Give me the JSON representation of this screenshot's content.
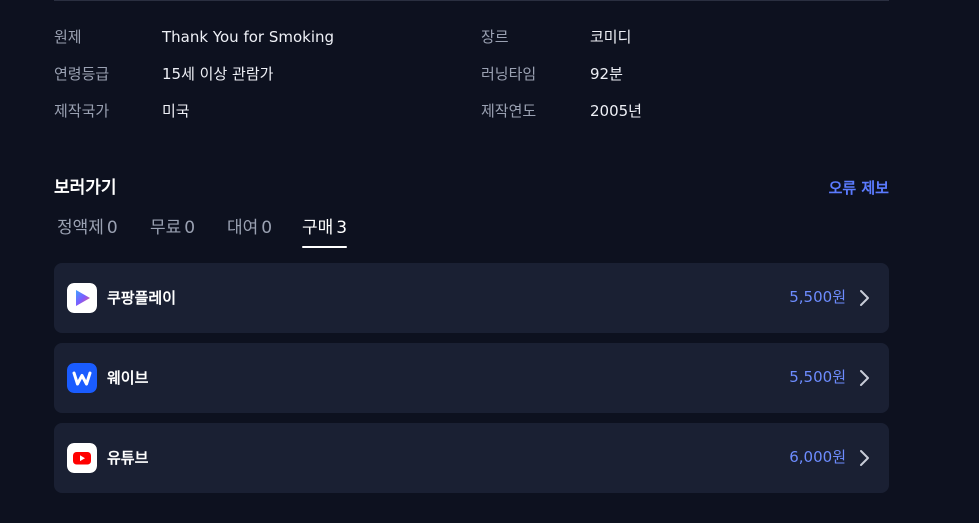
{
  "info": {
    "rows": [
      {
        "label1": "원제",
        "value1": "Thank You for Smoking",
        "label2": "장르",
        "value2": "코미디"
      },
      {
        "label1": "연령등급",
        "value1": "15세 이상 관람가",
        "label2": "러닝타임",
        "value2": "92분"
      },
      {
        "label1": "제작국가",
        "value1": "미국",
        "label2": "제작연도",
        "value2": "2005년"
      }
    ]
  },
  "watch": {
    "title": "보러가기",
    "report_label": "오류 제보",
    "tabs": [
      {
        "label": "정액제",
        "count": "0",
        "active": false
      },
      {
        "label": "무료",
        "count": "0",
        "active": false
      },
      {
        "label": "대여",
        "count": "0",
        "active": false
      },
      {
        "label": "구매",
        "count": "3",
        "active": true
      }
    ],
    "providers": [
      {
        "name": "쿠팡플레이",
        "price": "5,500원",
        "icon": "coupang-play-icon"
      },
      {
        "name": "웨이브",
        "price": "5,500원",
        "icon": "wavve-icon"
      },
      {
        "name": "유튜브",
        "price": "6,000원",
        "icon": "youtube-icon"
      }
    ]
  },
  "colors": {
    "background": "#0d111f",
    "card": "#1a2033",
    "accent": "#5b7bff",
    "price": "#6d8cff"
  }
}
